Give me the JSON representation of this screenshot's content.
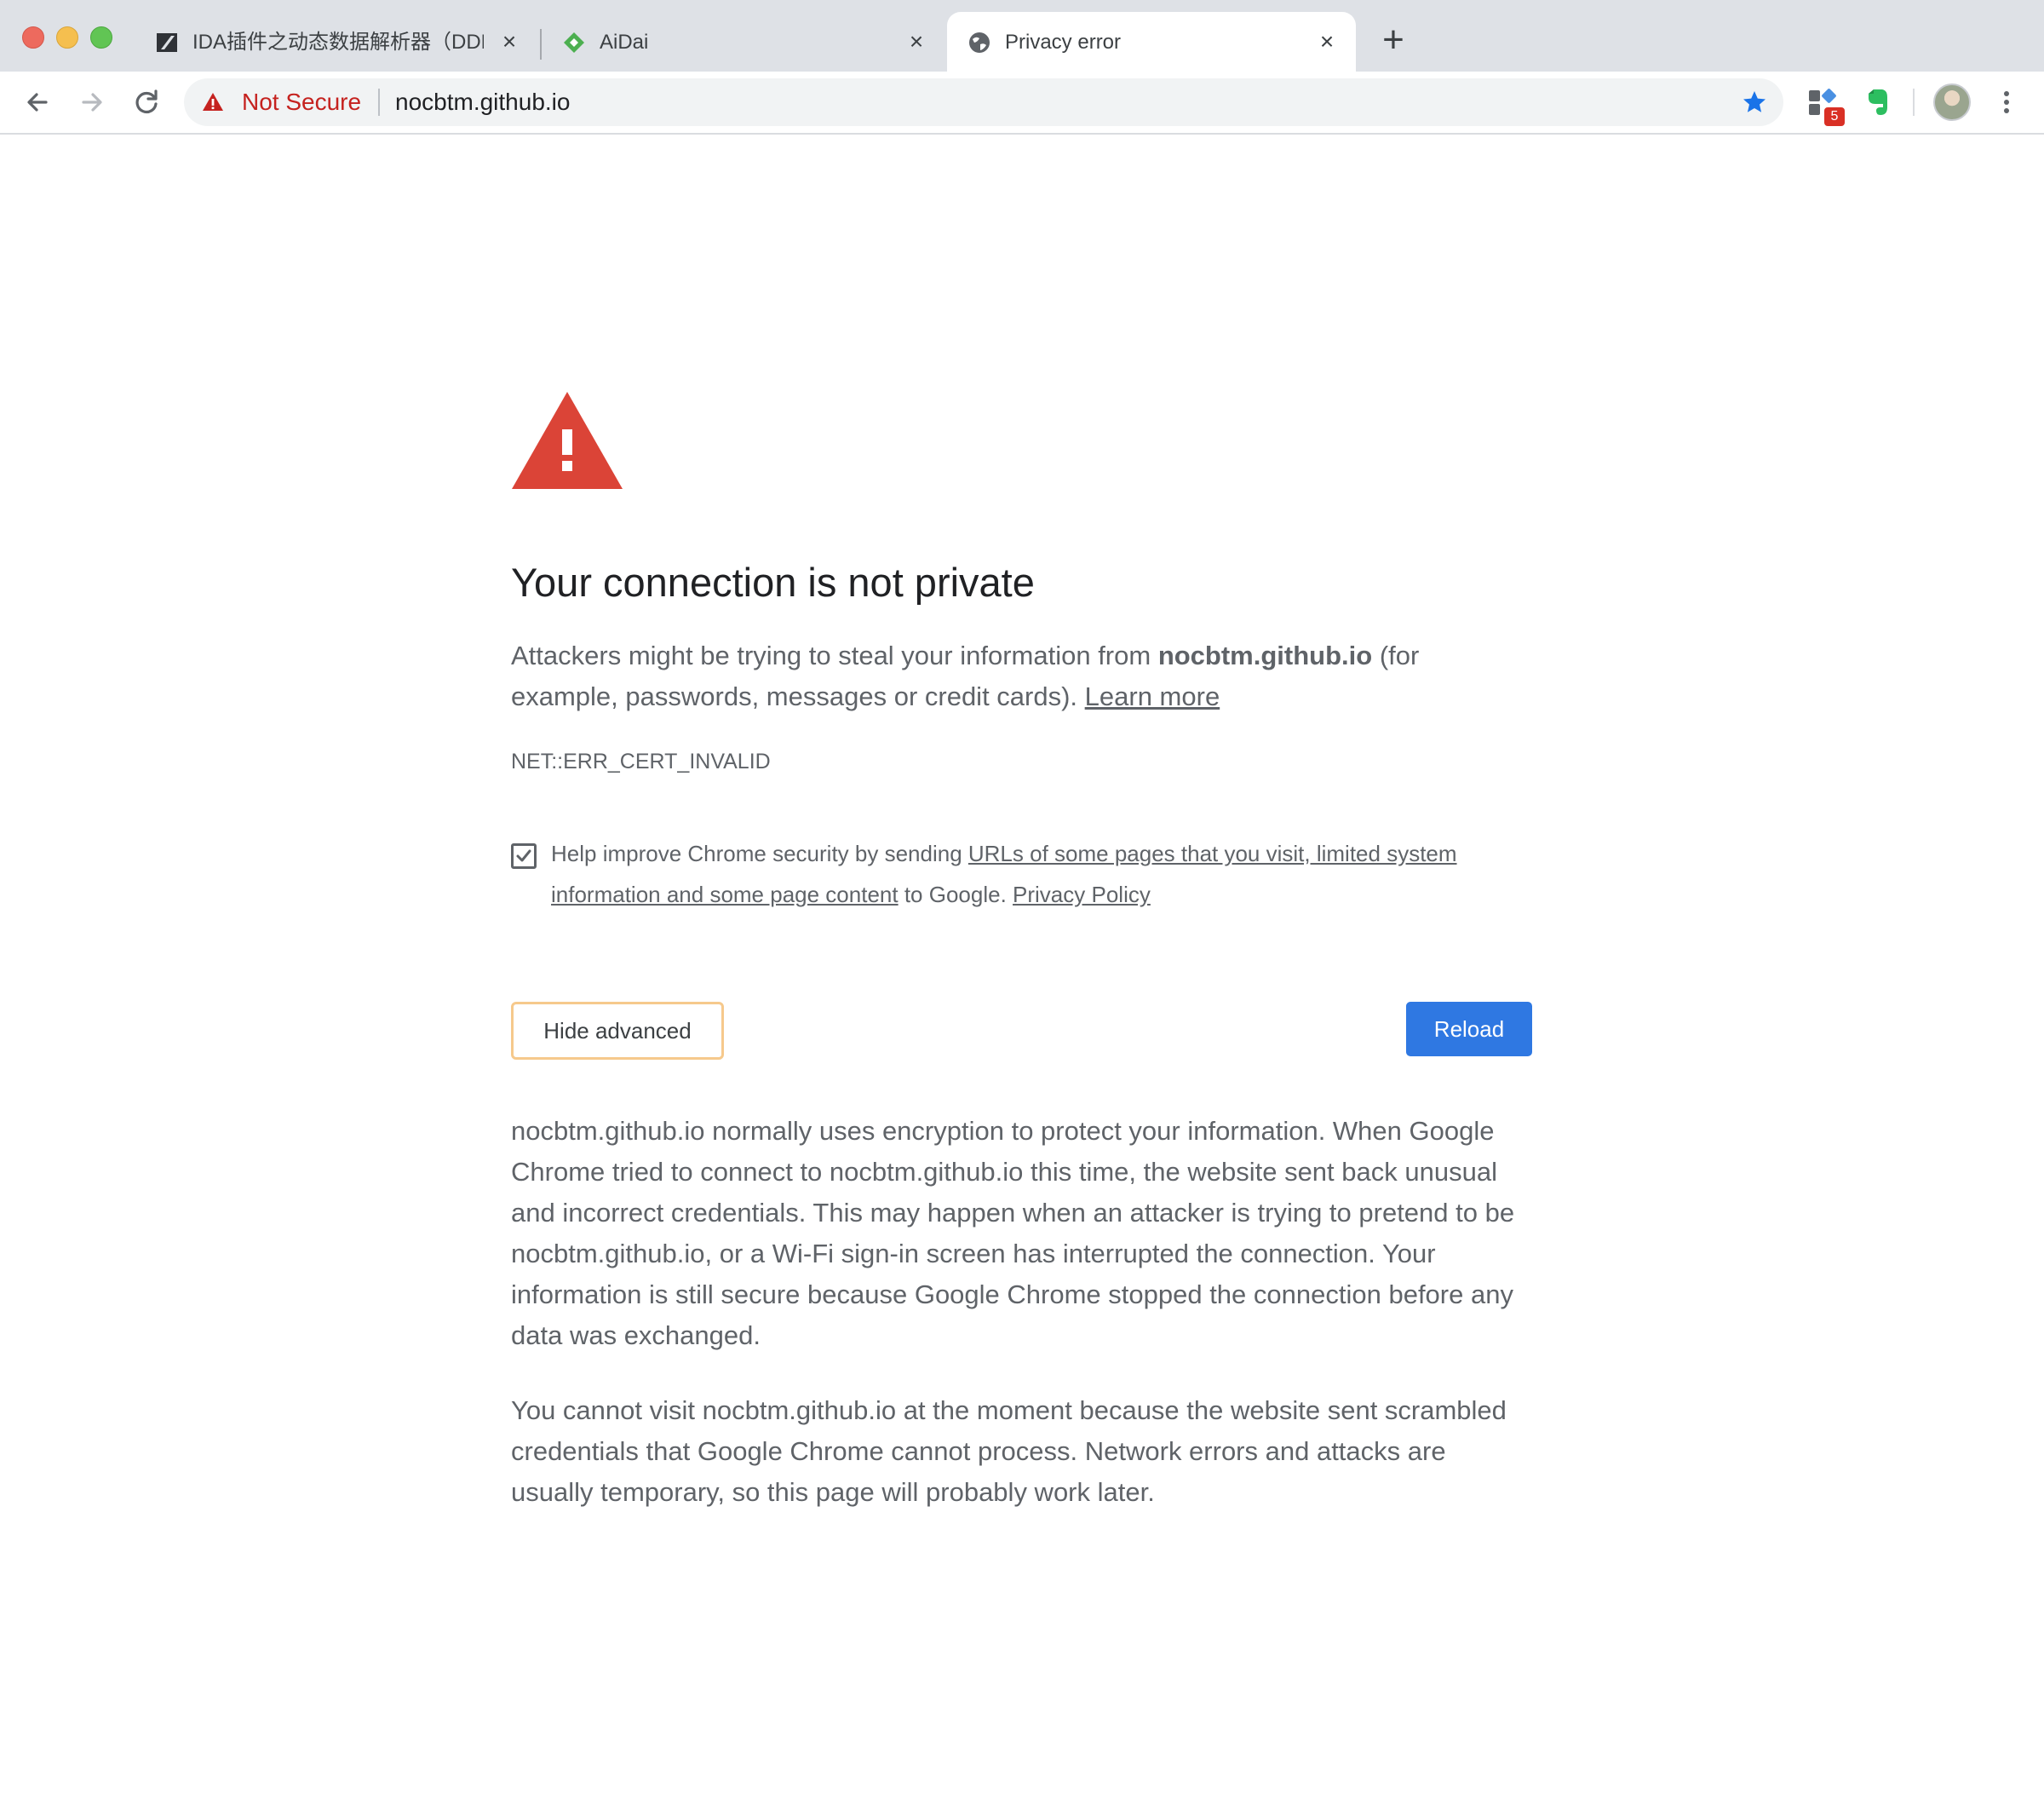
{
  "tabs": [
    {
      "title": "IDA插件之动态数据解析器（DDR）",
      "favicon": "zhi-icon"
    },
    {
      "title": "AiDai",
      "favicon": "aidai-leaf-icon"
    },
    {
      "title": "Privacy error",
      "favicon": "globe-icon"
    }
  ],
  "toolbar": {
    "security_label": "Not Secure",
    "url": "nocbtm.github.io",
    "extension_badge": "5"
  },
  "interstitial": {
    "heading": "Your connection is not private",
    "intro_before": "Attackers might be trying to steal your information from ",
    "intro_domain": "nocbtm.github.io",
    "intro_after": " (for example, passwords, messages or credit cards). ",
    "learn_more": "Learn more",
    "error_code": "NET::ERR_CERT_INVALID",
    "optin_before": "Help improve Chrome security by sending ",
    "optin_link": "URLs of some pages that you visit, limited system information and some page content",
    "optin_middle": " to Google. ",
    "privacy_policy": "Privacy Policy",
    "hide_advanced": "Hide advanced",
    "reload": "Reload",
    "details_1": "nocbtm.github.io normally uses encryption to protect your information. When Google Chrome tried to connect to nocbtm.github.io this time, the website sent back unusual and incorrect credentials. This may happen when an attacker is trying to pretend to be nocbtm.github.io, or a Wi-Fi sign-in screen has interrupted the connection. Your information is still secure because Google Chrome stopped the connection before any data was exchanged.",
    "details_2": "You cannot visit nocbtm.github.io at the moment because the website sent scrambled credentials that Google Chrome cannot process. Network errors and attacks are usually temporary, so this page will probably work later."
  },
  "colors": {
    "warning_red": "#db4437",
    "not_secure_red": "#c5221f",
    "reload_blue": "#2f78e2",
    "star_blue": "#1a73e8",
    "hide_advanced_border": "#f6c98c"
  }
}
